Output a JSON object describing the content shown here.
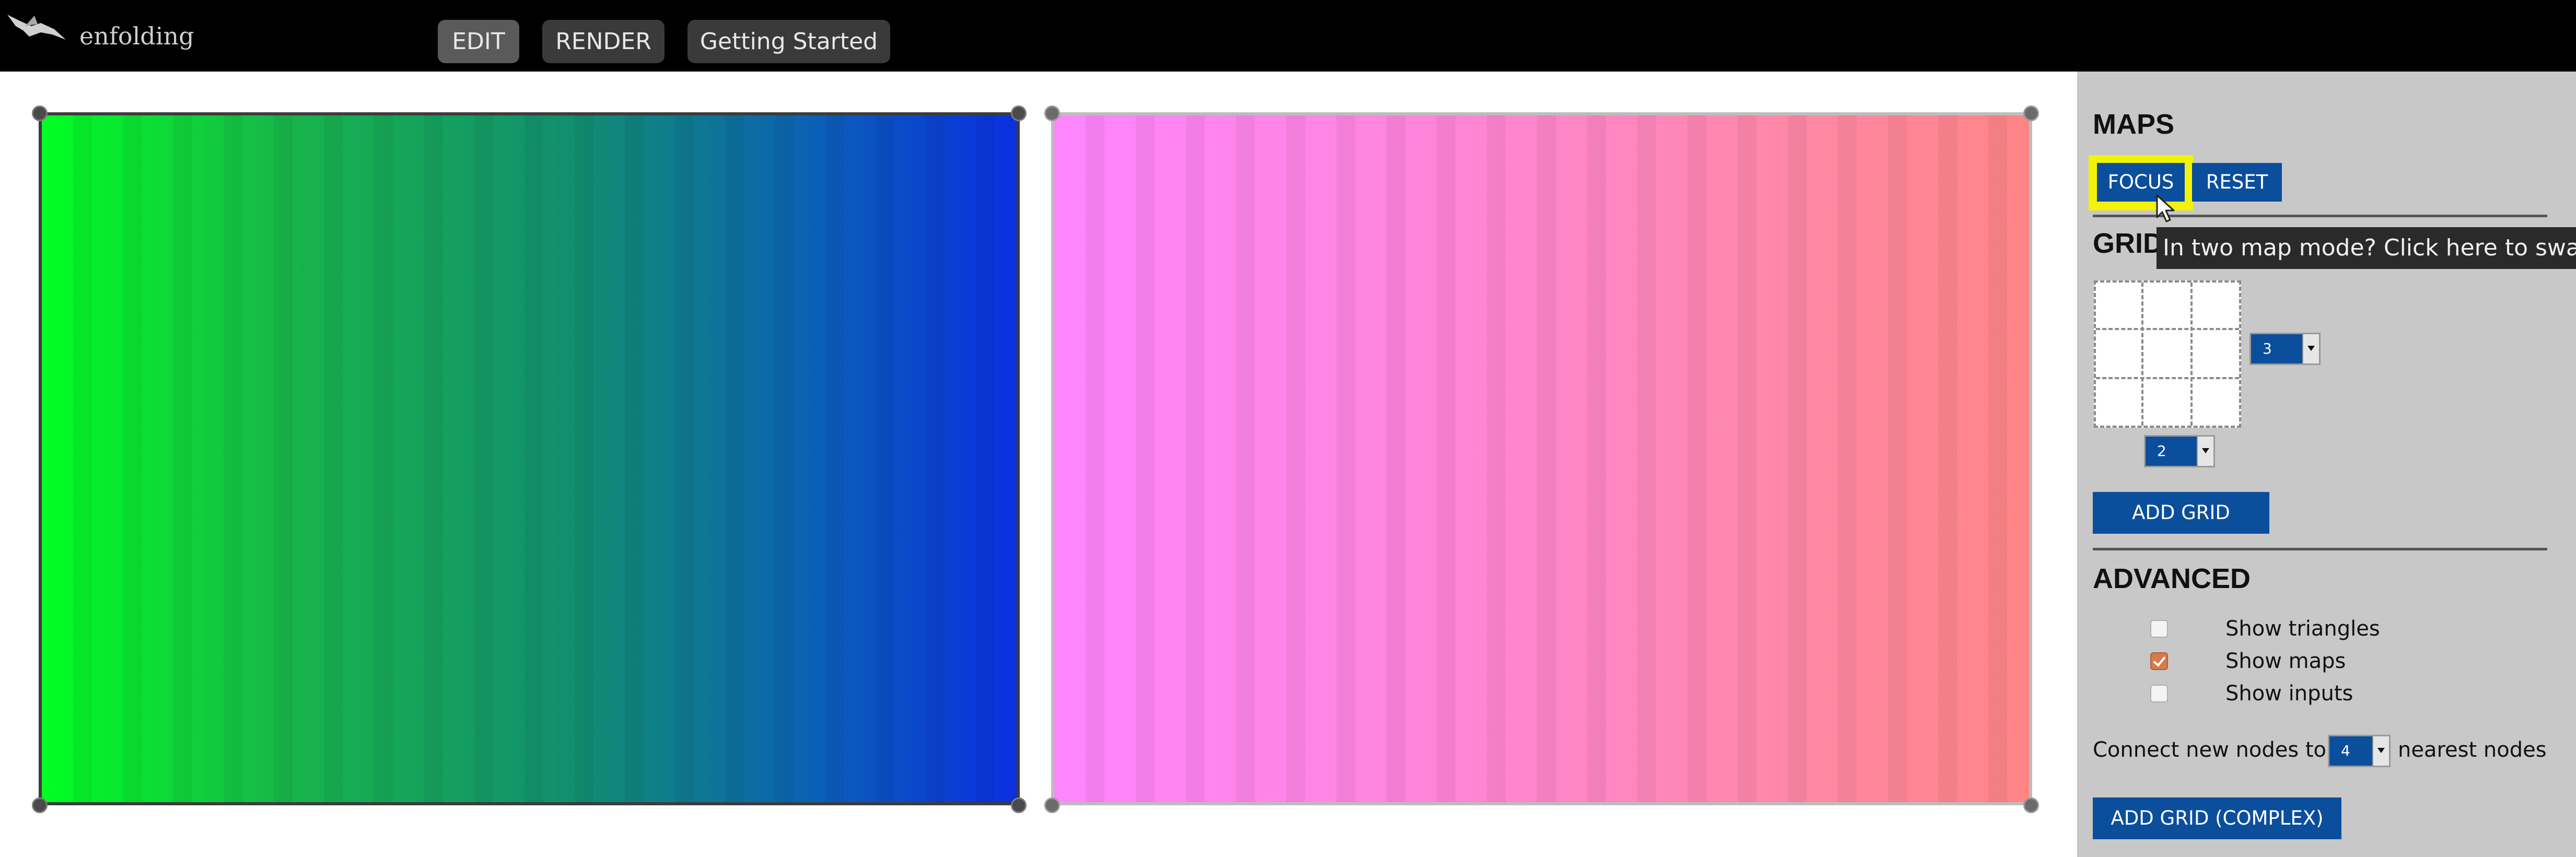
{
  "header": {
    "app_title": "enfolding",
    "logo_icon": "bird-logo-icon",
    "nav": {
      "edit": "EDIT",
      "render": "RENDER",
      "getting_started": "Getting Started"
    },
    "active_tab": "EDIT"
  },
  "maps": {
    "left_gradient": [
      "#00ff22",
      "#0a2fe0"
    ],
    "right_gradient": [
      "#ff85ff",
      "#ff8585"
    ]
  },
  "panel": {
    "maps_heading": "MAPS",
    "focus_label": "FOCUS",
    "reset_label": "RESET",
    "tooltip": "In two map mode? Click here to swap m",
    "grid_heading": "GRID",
    "columns_value": "3",
    "rows_value": "2",
    "add_grid_label": "ADD GRID",
    "advanced_heading": "ADVANCED",
    "checkboxes": [
      {
        "label": "Show triangles",
        "checked": false
      },
      {
        "label": "Show maps",
        "checked": true
      },
      {
        "label": "Show inputs",
        "checked": false
      }
    ],
    "connect_label": "Connect new nodes to:",
    "connect_value": "4",
    "connect_suffix": "nearest nodes",
    "add_grid_complex_label": "ADD GRID (COMPLEX)"
  },
  "colors": {
    "accent_blue": "#0b4f9c",
    "highlight_yellow": "#f2f20a",
    "panel_bg": "#c8c8c8",
    "topbar_bg": "#000000"
  }
}
